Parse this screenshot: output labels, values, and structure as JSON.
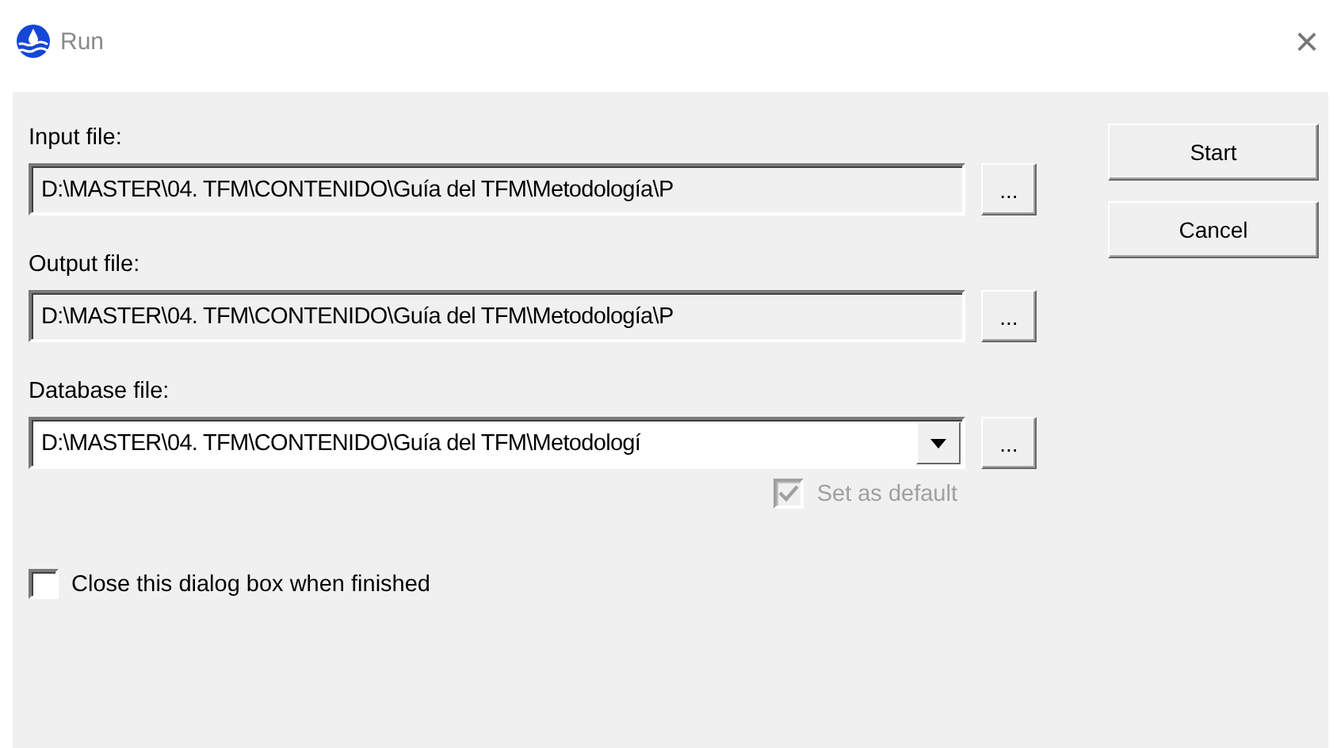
{
  "window": {
    "title": "Run",
    "close": "×"
  },
  "files": [
    {
      "kind": "text",
      "label": "Input file:",
      "value": "D:\\MASTER\\04. TFM\\CONTENIDO\\Guía del TFM\\Metodología\\P",
      "browse": "..."
    },
    {
      "kind": "text",
      "label": "Output file:",
      "value": "D:\\MASTER\\04. TFM\\CONTENIDO\\Guía del TFM\\Metodología\\P",
      "browse": "..."
    },
    {
      "kind": "combo",
      "label": "Database file:",
      "value": "D:\\MASTER\\04. TFM\\CONTENIDO\\Guía del TFM\\Metodologí",
      "browse": "..."
    }
  ],
  "set_default": {
    "label": "Set as default",
    "checked": true,
    "disabled": true
  },
  "close_when_finished": {
    "label": "Close this dialog box when finished",
    "checked": false,
    "disabled": false
  },
  "buttons": [
    "Start",
    "Cancel"
  ]
}
